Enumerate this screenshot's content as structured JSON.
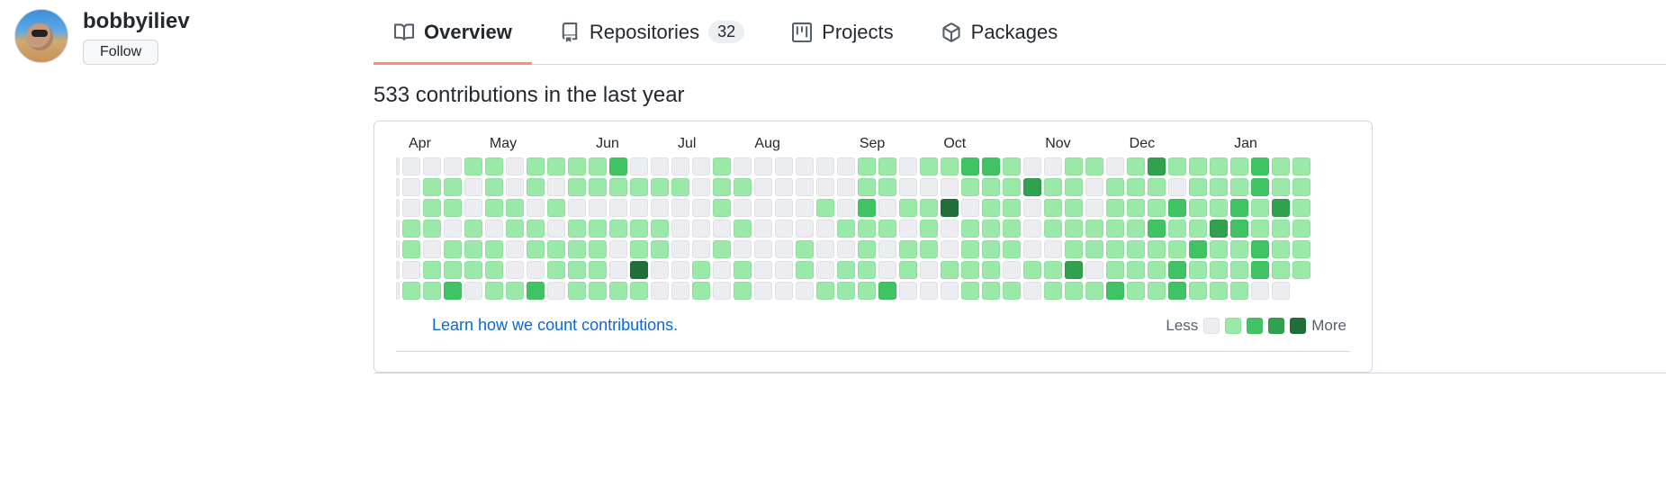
{
  "user": {
    "username": "bobbyiliev",
    "follow_label": "Follow"
  },
  "tabs": {
    "overview": "Overview",
    "repositories": "Repositories",
    "repositories_count": "32",
    "projects": "Projects",
    "packages": "Packages"
  },
  "contributions": {
    "heading": "533 contributions in the last year",
    "learn_link": "Learn how we count contributions.",
    "legend_less": "Less",
    "legend_more": "More",
    "months": [
      "Apr",
      "May",
      "Jun",
      "Jul",
      "Aug",
      "Sep",
      "Oct",
      "Nov",
      "Dec",
      "Jan"
    ],
    "month_offsets": [
      0,
      4,
      9,
      13,
      17,
      22,
      26,
      31,
      35,
      40
    ],
    "levels": {
      "colors": [
        "#ebedf0",
        "#9be9a8",
        "#40c463",
        "#30a14e",
        "#216e39"
      ]
    },
    "weeks": [
      [
        0,
        0,
        0,
        1,
        1,
        0,
        1
      ],
      [
        0,
        1,
        1,
        1,
        0,
        1,
        1
      ],
      [
        0,
        1,
        1,
        0,
        1,
        1,
        2
      ],
      [
        1,
        0,
        0,
        1,
        1,
        1,
        0
      ],
      [
        1,
        1,
        1,
        0,
        1,
        1,
        1
      ],
      [
        0,
        0,
        1,
        1,
        0,
        0,
        1
      ],
      [
        1,
        1,
        0,
        1,
        1,
        0,
        2
      ],
      [
        1,
        0,
        1,
        0,
        1,
        1,
        0
      ],
      [
        1,
        1,
        0,
        1,
        1,
        1,
        1
      ],
      [
        1,
        1,
        0,
        1,
        1,
        1,
        1
      ],
      [
        2,
        1,
        0,
        1,
        0,
        0,
        1
      ],
      [
        0,
        1,
        0,
        1,
        1,
        4,
        1
      ],
      [
        0,
        1,
        0,
        1,
        1,
        0,
        0
      ],
      [
        0,
        1,
        0,
        0,
        0,
        0,
        0
      ],
      [
        0,
        0,
        0,
        0,
        0,
        1,
        1
      ],
      [
        1,
        1,
        1,
        0,
        1,
        0,
        0
      ],
      [
        0,
        1,
        0,
        1,
        0,
        1,
        1
      ],
      [
        0,
        0,
        0,
        0,
        0,
        0,
        0
      ],
      [
        0,
        0,
        0,
        0,
        0,
        0,
        0
      ],
      [
        0,
        0,
        0,
        0,
        1,
        1,
        0
      ],
      [
        0,
        0,
        1,
        0,
        0,
        0,
        1
      ],
      [
        0,
        0,
        0,
        1,
        0,
        1,
        1
      ],
      [
        1,
        1,
        2,
        1,
        1,
        1,
        1
      ],
      [
        1,
        1,
        0,
        1,
        0,
        0,
        2
      ],
      [
        0,
        0,
        1,
        0,
        1,
        1,
        0
      ],
      [
        1,
        0,
        1,
        1,
        1,
        0,
        0
      ],
      [
        1,
        0,
        4,
        0,
        0,
        1,
        0
      ],
      [
        2,
        1,
        0,
        1,
        1,
        1,
        1
      ],
      [
        2,
        1,
        1,
        1,
        1,
        1,
        1
      ],
      [
        1,
        1,
        1,
        1,
        1,
        0,
        1
      ],
      [
        0,
        3,
        0,
        0,
        0,
        1,
        0
      ],
      [
        0,
        1,
        1,
        1,
        0,
        1,
        1
      ],
      [
        1,
        1,
        1,
        1,
        1,
        3,
        1
      ],
      [
        1,
        0,
        0,
        1,
        1,
        0,
        1
      ],
      [
        0,
        1,
        1,
        1,
        1,
        1,
        2
      ],
      [
        1,
        1,
        1,
        1,
        1,
        1,
        1
      ],
      [
        3,
        1,
        1,
        2,
        1,
        1,
        1
      ],
      [
        1,
        0,
        2,
        1,
        1,
        2,
        2
      ],
      [
        1,
        1,
        1,
        1,
        2,
        1,
        1
      ],
      [
        1,
        1,
        1,
        3,
        1,
        1,
        1
      ],
      [
        1,
        1,
        2,
        2,
        1,
        1,
        1
      ],
      [
        2,
        2,
        1,
        1,
        2,
        2,
        0
      ],
      [
        1,
        1,
        3,
        1,
        1,
        1,
        0
      ],
      [
        1,
        1,
        1,
        1,
        1,
        1,
        -1
      ]
    ]
  }
}
